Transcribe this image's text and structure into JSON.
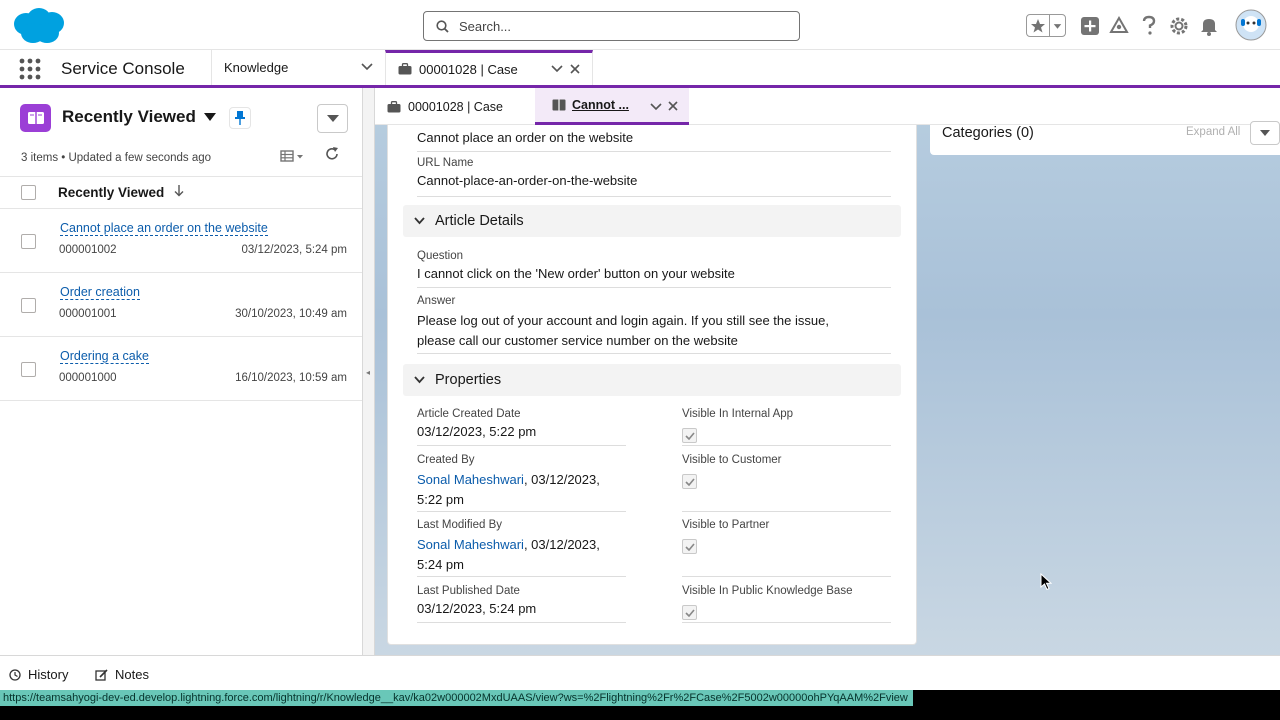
{
  "topbar": {
    "search_placeholder": "Search..."
  },
  "navbar": {
    "app_name": "Service Console",
    "nav_selector": "Knowledge",
    "workspace_tab": "00001028 | Case"
  },
  "left_panel": {
    "title": "Recently Viewed",
    "meta": "3 items • Updated a few seconds ago",
    "column_header": "Recently Viewed",
    "rows": [
      {
        "title": "Cannot place an order on the website",
        "number": "000001002",
        "date": "03/12/2023, 5:24 pm"
      },
      {
        "title": "Order creation",
        "number": "000001001",
        "date": "30/10/2023, 10:49 am"
      },
      {
        "title": "Ordering a cake",
        "number": "000001000",
        "date": "16/10/2023, 10:59 am"
      }
    ]
  },
  "subtabs": {
    "case_tab": "00001028 | Case",
    "article_tab": "Cannot ..."
  },
  "article": {
    "title_value": "Cannot place an order on the website",
    "url_name_label": "URL Name",
    "url_name_value": "Cannot-place-an-order-on-the-website",
    "details_section": "Article Details",
    "question_label": "Question",
    "question_value": "I cannot click on the 'New order' button on your website",
    "answer_label": "Answer",
    "answer_line1": "Please log out of your account and login again. If you still see the issue,",
    "answer_line2": "please call our customer service number on the website",
    "properties_section": "Properties",
    "created_date_label": "Article Created Date",
    "created_date_value": "03/12/2023, 5:22 pm",
    "created_by_label": "Created By",
    "created_by_user": "Sonal Maheshwari",
    "created_by_date_a": ", 03/12/2023,",
    "created_by_date_b": "5:22 pm",
    "modified_by_label": "Last Modified By",
    "modified_by_user": "Sonal Maheshwari",
    "modified_by_date_a": ", 03/12/2023,",
    "modified_by_date_b": "5:24 pm",
    "published_label": "Last Published Date",
    "published_value": "03/12/2023, 5:24 pm",
    "vis_internal_label": "Visible In Internal App",
    "vis_customer_label": "Visible to Customer",
    "vis_partner_label": "Visible to Partner",
    "vis_public_label": "Visible In Public Knowledge Base"
  },
  "categories": {
    "title": "Categories (0)",
    "expand_all": "Expand All"
  },
  "footer": {
    "history": "History",
    "notes": "Notes"
  },
  "status_url": "https://teamsahyogi-dev-ed.develop.lightning.force.com/lightning/r/Knowledge__kav/ka02w000002MxdUAAS/view?ws=%2Flightning%2Fr%2FCase%2F5002w00000ohPYqAAM%2Fview",
  "colors": {
    "brand": "#0176d3",
    "accent": "#7526a9",
    "link": "#0b5cab"
  }
}
